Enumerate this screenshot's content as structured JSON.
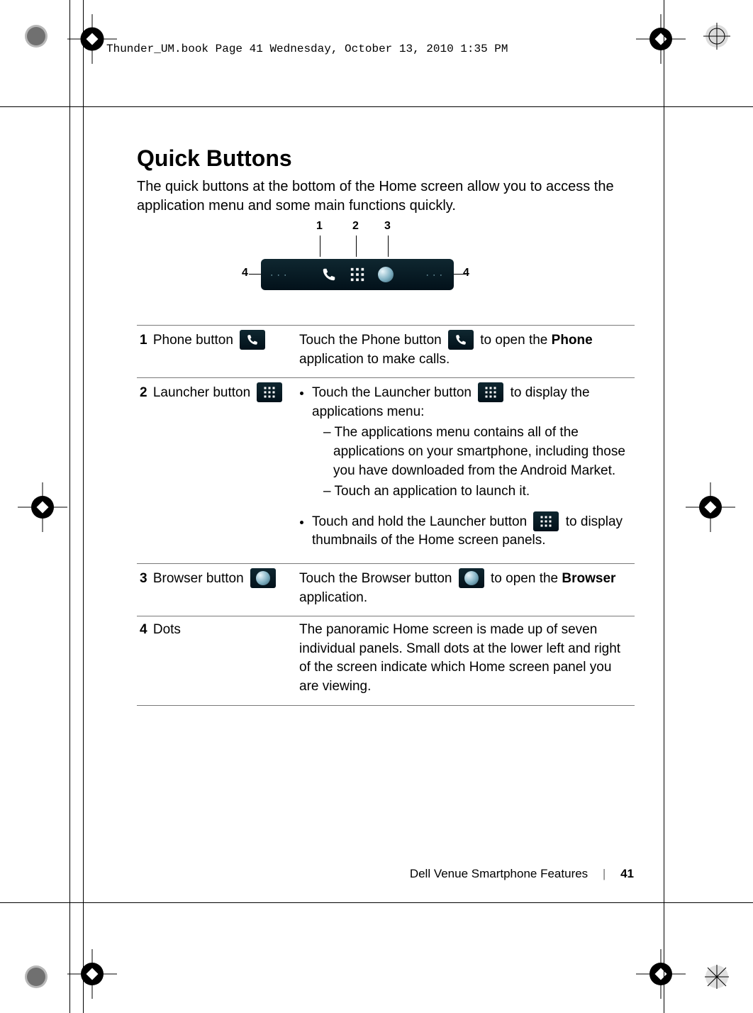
{
  "running_header": "Thunder_UM.book  Page 41  Wednesday, October 13, 2010  1:35 PM",
  "title": "Quick Buttons",
  "intro": "The quick buttons at the bottom of the Home screen allow you to access the application menu and some main functions quickly.",
  "callouts": {
    "c1": "1",
    "c2": "2",
    "c3": "3",
    "c4": "4"
  },
  "rows": {
    "r1": {
      "num": "1",
      "name": "Phone button",
      "d_pre": "Touch the Phone button ",
      "d_post": " to open the ",
      "bold": "Phone",
      "tail": " application to make calls."
    },
    "r2": {
      "num": "2",
      "name": "Launcher button",
      "b1_pre": "Touch the Launcher button ",
      "b1_post": " to display the applications menu:",
      "dash1": "– The applications menu contains all of the applications on your smartphone, including those you have downloaded from the Android Market.",
      "dash2": "– Touch an application to launch it.",
      "b2_pre": "Touch and hold the Launcher button ",
      "b2_post": " to display thumbnails of the Home screen panels."
    },
    "r3": {
      "num": "3",
      "name": "Browser button",
      "d_pre": "Touch the Browser button ",
      "d_post": " to open the ",
      "bold": "Browser",
      "tail": " application."
    },
    "r4": {
      "num": "4",
      "name": "Dots",
      "d": "The panoramic Home screen is made up of seven individual panels. Small dots at the lower left and right of the screen indicate which Home screen panel you are viewing."
    }
  },
  "footer": {
    "label": "Dell Venue Smartphone Features",
    "page": "41"
  }
}
